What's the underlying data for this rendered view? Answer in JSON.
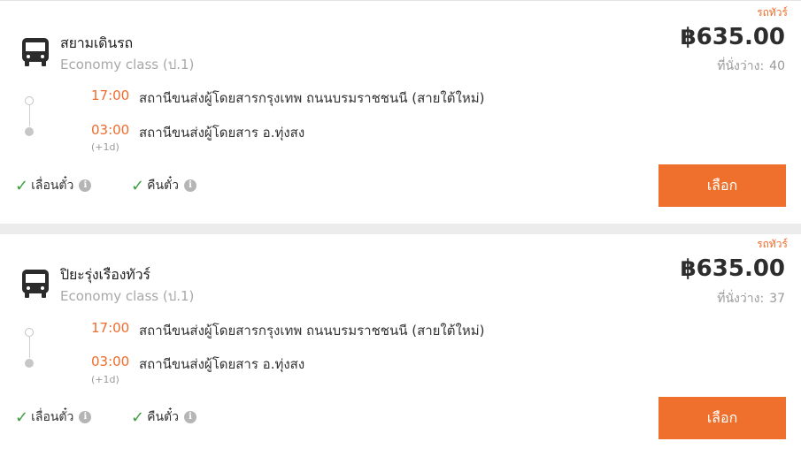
{
  "trips": [
    {
      "type_tag": "รถทัวร์",
      "operator": "สยามเดินรถ",
      "class": "Economy class (ป.1)",
      "price": "฿635.00",
      "seats_label": "ที่นั่งว่าง:",
      "seats_value": "40",
      "departure_time": "17:00",
      "departure_station": "สถานีขนส่งผู้โดยสารกรุงเทพ ถนนบรมราชชนนี (สายใต้ใหม่)",
      "arrival_time": "03:00",
      "arrival_station": "สถานีขนส่งผู้โดยสาร อ.ทุ่งสง",
      "arrival_day_offset": "(+1d)",
      "feature_reschedule": "เลื่อนตั๋ว",
      "feature_refund": "คืนตั๋ว",
      "select_label": "เลือก"
    },
    {
      "type_tag": "รถทัวร์",
      "operator": "ปิยะรุ่งเรืองทัวร์",
      "class": "Economy class (ป.1)",
      "price": "฿635.00",
      "seats_label": "ที่นั่งว่าง:",
      "seats_value": "37",
      "departure_time": "17:00",
      "departure_station": "สถานีขนส่งผู้โดยสารกรุงเทพ ถนนบรมราชชนนี (สายใต้ใหม่)",
      "arrival_time": "03:00",
      "arrival_station": "สถานีขนส่งผู้โดยสาร อ.ทุ่งสง",
      "arrival_day_offset": "(+1d)",
      "feature_reschedule": "เลื่อนตั๋ว",
      "feature_refund": "คืนตั๋ว",
      "select_label": "เลือก"
    }
  ],
  "icons": {
    "bus": "bus-icon",
    "check": "check-icon",
    "info": "info-icon"
  },
  "colors": {
    "accent": "#ef702d",
    "check": "#3e9e3e",
    "price": "#2d2d2d"
  }
}
